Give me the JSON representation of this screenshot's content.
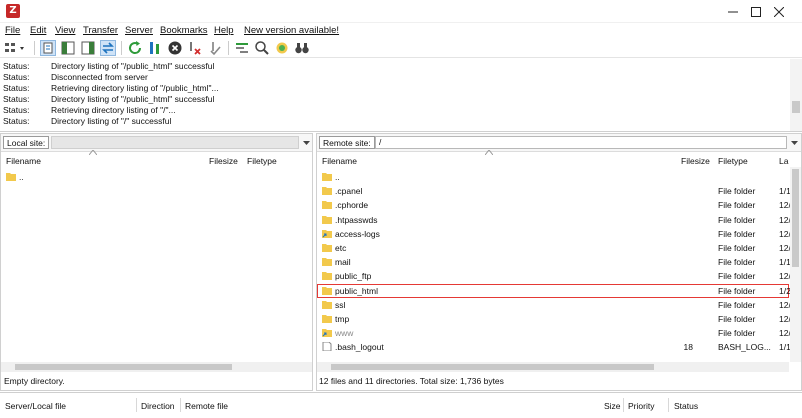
{
  "window": {
    "app_icon_letter": "Z",
    "minimize_glyph": "—",
    "maximize_glyph": "☐",
    "close_glyph": "✕"
  },
  "menu": [
    "File",
    "Edit",
    "View",
    "Transfer",
    "Server",
    "Bookmarks",
    "Help",
    "New version available!"
  ],
  "toolbar": {
    "icons": [
      "site-manager-icon",
      "toggle-log-icon",
      "toggle-local-tree-icon",
      "toggle-remote-tree-icon",
      "toggle-queue-icon",
      "refresh-icon",
      "process-queue-icon",
      "cancel-icon",
      "cancel-disconnect-icon",
      "reconnect-icon",
      "directory-compare-icon",
      "filter-icon",
      "search-icon",
      "sync-browse-icon",
      "binoculars-icon"
    ]
  },
  "log": [
    {
      "label": "Status:",
      "message": "Directory listing of \"/public_html\" successful"
    },
    {
      "label": "Status:",
      "message": "Disconnected from server"
    },
    {
      "label": "Status:",
      "message": "Retrieving directory listing of \"/public_html\"..."
    },
    {
      "label": "Status:",
      "message": "Directory listing of \"/public_html\" successful"
    },
    {
      "label": "Status:",
      "message": "Retrieving directory listing of \"/\"..."
    },
    {
      "label": "Status:",
      "message": "Directory listing of \"/\" successful"
    }
  ],
  "local": {
    "site_label": "Local site:",
    "path": "",
    "columns": {
      "filename": "Filename",
      "filesize": "Filesize",
      "filetype": "Filetype"
    },
    "files": [
      {
        "name": "..",
        "size": "",
        "type": ""
      }
    ],
    "status": "Empty directory."
  },
  "remote": {
    "site_label": "Remote site:",
    "path": "/",
    "columns": {
      "filename": "Filename",
      "filesize": "Filesize",
      "filetype": "Filetype",
      "lastmod": "La"
    },
    "files": [
      {
        "name": "..",
        "size": "",
        "type": "",
        "mod": "",
        "icon": "folder-icon"
      },
      {
        "name": ".cpanel",
        "size": "",
        "type": "File folder",
        "mod": "1/1",
        "icon": "folder-icon"
      },
      {
        "name": ".cphorde",
        "size": "",
        "type": "File folder",
        "mod": "12/",
        "icon": "folder-icon"
      },
      {
        "name": ".htpasswds",
        "size": "",
        "type": "File folder",
        "mod": "12/",
        "icon": "folder-icon"
      },
      {
        "name": "access-logs",
        "size": "",
        "type": "File folder",
        "mod": "12/",
        "icon": "folder-link-icon"
      },
      {
        "name": "etc",
        "size": "",
        "type": "File folder",
        "mod": "12/",
        "icon": "folder-icon"
      },
      {
        "name": "mail",
        "size": "",
        "type": "File folder",
        "mod": "1/1",
        "icon": "folder-icon"
      },
      {
        "name": "public_ftp",
        "size": "",
        "type": "File folder",
        "mod": "12/",
        "icon": "folder-icon"
      },
      {
        "name": "public_html",
        "size": "",
        "type": "File folder",
        "mod": "1/2",
        "icon": "folder-icon",
        "highlighted": true
      },
      {
        "name": "ssl",
        "size": "",
        "type": "File folder",
        "mod": "12/",
        "icon": "folder-icon"
      },
      {
        "name": "tmp",
        "size": "",
        "type": "File folder",
        "mod": "12/",
        "icon": "folder-icon"
      },
      {
        "name": "www",
        "size": "",
        "type": "File folder",
        "mod": "12/",
        "icon": "folder-link-icon",
        "dimmed": true
      },
      {
        "name": ".bash_logout",
        "size": "18",
        "type": "BASH_LOG...",
        "mod": "1/1",
        "icon": "file-icon"
      }
    ],
    "status": "12 files and 11 directories. Total size: 1,736 bytes"
  },
  "queue": {
    "columns": [
      "Server/Local file",
      "Direction",
      "Remote file",
      "Size",
      "Priority",
      "Status"
    ]
  },
  "colors": {
    "folder": "#f2c94c",
    "highlight": "#e53935",
    "accent": "#1e73be"
  }
}
